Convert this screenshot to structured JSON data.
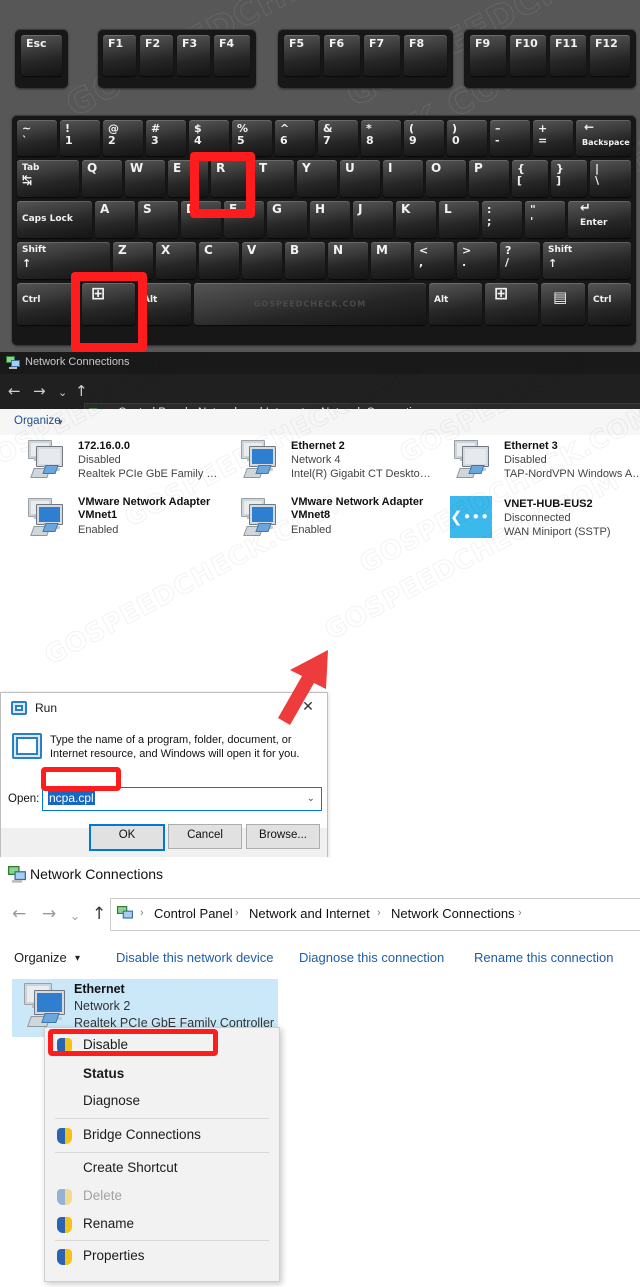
{
  "keyboard": {
    "watermark": "GOSPEEDCHECK.COM",
    "spacebar_watermark": "GOSPEEDCHECK.COM",
    "esc": "Esc",
    "function_keys": [
      "F1",
      "F2",
      "F3",
      "F4",
      "F5",
      "F6",
      "F7",
      "F8",
      "F9",
      "F10",
      "F11",
      "F12"
    ],
    "number_row": [
      {
        "top": "~",
        "bottom": "`"
      },
      {
        "top": "!",
        "bottom": "1"
      },
      {
        "top": "@",
        "bottom": "2"
      },
      {
        "top": "#",
        "bottom": "3"
      },
      {
        "top": "$",
        "bottom": "4"
      },
      {
        "top": "%",
        "bottom": "5"
      },
      {
        "top": "^",
        "bottom": "6"
      },
      {
        "top": "&",
        "bottom": "7"
      },
      {
        "top": "*",
        "bottom": "8"
      },
      {
        "top": "(",
        "bottom": "9"
      },
      {
        "top": ")",
        "bottom": "0"
      },
      {
        "top": "–",
        "bottom": "-"
      },
      {
        "top": "+",
        "bottom": "="
      }
    ],
    "backspace": "Backspace",
    "backspace_arrow": "←",
    "tab": "Tab",
    "tab_arrow": "↹",
    "row_q": [
      "Q",
      "W",
      "E",
      "R",
      "T",
      "Y",
      "U",
      "I",
      "O",
      "P"
    ],
    "row_q_extra": [
      {
        "top": "{",
        "bottom": "["
      },
      {
        "top": "}",
        "bottom": "]"
      },
      {
        "top": "|",
        "bottom": "\\"
      }
    ],
    "caps_lock": "Caps Lock",
    "row_a": [
      "A",
      "S",
      "D",
      "F",
      "G",
      "H",
      "J",
      "K",
      "L"
    ],
    "row_a_extra": [
      {
        "top": ":",
        "bottom": ";"
      },
      {
        "top": "\"",
        "bottom": "'"
      }
    ],
    "enter": "Enter",
    "enter_arrow": "↵",
    "shift_left": "Shift",
    "shift_right": "Shift",
    "shift_arrow": "↑",
    "row_z": [
      "Z",
      "X",
      "C",
      "V",
      "B",
      "N",
      "M"
    ],
    "row_z_extra": [
      {
        "top": "<",
        "bottom": ","
      },
      {
        "top": ">",
        "bottom": "."
      },
      {
        "top": "?",
        "bottom": "/"
      }
    ],
    "ctrl_left": "Ctrl",
    "ctrl_right": "Ctrl",
    "alt_left": "Alt",
    "alt_right": "Alt",
    "win_key": "⊞",
    "menu_key": "▤",
    "highlighted_keys": [
      "R",
      "Windows"
    ]
  },
  "window_top": {
    "title": "Network Connections",
    "title_icon": "network-connections-icon",
    "nav": {
      "back": "←",
      "forward": "→",
      "recent": "⌄",
      "up": "↑"
    },
    "breadcrumb": [
      "Control Panel",
      "Network and Internet",
      "Network Connections"
    ],
    "breadcrumb_separator": "›",
    "command_bar": {
      "organize": "Organize",
      "organize_caret": "▾"
    },
    "connections": [
      {
        "name": "172.16.0.0",
        "status": "Disabled",
        "device": "Realtek PCIe GbE Family Cont...",
        "icon": "ethernet-adapter-icon"
      },
      {
        "name": "Ethernet 2",
        "status": "Network 4",
        "device": "Intel(R) Gigabit CT Desktop A...",
        "icon": "ethernet-adapter-icon"
      },
      {
        "name": "Ethernet 3",
        "status": "Disabled",
        "device": "TAP-NordVPN Windows Ada...",
        "icon": "ethernet-adapter-icon"
      },
      {
        "name": "VMware Network Adapter VMnet1",
        "status": "Enabled",
        "device": "",
        "icon": "ethernet-adapter-icon"
      },
      {
        "name": "VMware Network Adapter VMnet8",
        "status": "Enabled",
        "device": "",
        "icon": "ethernet-adapter-icon"
      },
      {
        "name": "VNET-HUB-EUS2",
        "status": "Disconnected",
        "device": "WAN Miniport (SSTP)",
        "icon": "vpn-connection-icon"
      }
    ]
  },
  "run_dialog": {
    "title": "Run",
    "title_icon": "run-icon",
    "close": "✕",
    "description": "Type the name of a program, folder, document, or Internet resource, and Windows will open it for you.",
    "open_label": "Open:",
    "input_value": "ncpa.cpl",
    "dropdown_caret": "⌄",
    "buttons": {
      "ok": "OK",
      "cancel": "Cancel",
      "browse": "Browse..."
    }
  },
  "window_bottom": {
    "title": "Network Connections",
    "title_icon": "network-connections-icon",
    "nav": {
      "back": "←",
      "forward": "→",
      "recent": "⌄",
      "up": "↑"
    },
    "breadcrumb": [
      "Control Panel",
      "Network and Internet",
      "Network Connections"
    ],
    "breadcrumb_separator": "›",
    "command_bar": {
      "organize": "Organize",
      "organize_caret": "▾",
      "disable_device": "Disable this network device",
      "diagnose": "Diagnose this connection",
      "rename": "Rename this connection"
    },
    "selected_connection": {
      "name": "Ethernet",
      "status": "Network 2",
      "device": "Realtek PCIe GbE Family Controller",
      "icon": "ethernet-adapter-icon"
    },
    "context_menu": [
      {
        "label": "Disable",
        "shield": true,
        "bold": false,
        "disabled": false,
        "highlight": true
      },
      {
        "label": "Status",
        "shield": false,
        "bold": true,
        "disabled": false,
        "highlight": false
      },
      {
        "label": "Diagnose",
        "shield": false,
        "bold": false,
        "disabled": false,
        "highlight": false
      },
      {
        "label": "Bridge Connections",
        "shield": true,
        "bold": false,
        "disabled": false,
        "highlight": false
      },
      {
        "label": "Create Shortcut",
        "shield": false,
        "bold": false,
        "disabled": false,
        "highlight": false
      },
      {
        "label": "Delete",
        "shield": true,
        "bold": false,
        "disabled": true,
        "highlight": false
      },
      {
        "label": "Rename",
        "shield": true,
        "bold": false,
        "disabled": false,
        "highlight": false
      },
      {
        "label": "Properties",
        "shield": true,
        "bold": false,
        "disabled": false,
        "highlight": false
      }
    ]
  },
  "annotations": {
    "accent_red": "#FF1C1C",
    "arrow_red": "#EE3B3B",
    "selection_blue": "#CBE8F8",
    "link_blue": "#1F5DAA",
    "vpn_icon_blue": "#3BB8EC"
  }
}
